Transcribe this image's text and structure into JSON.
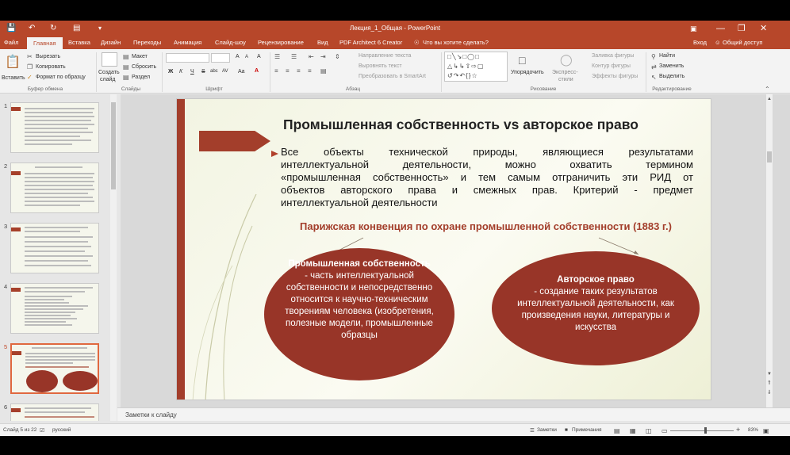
{
  "window": {
    "title": "Лекция_1_Общая - PowerPoint",
    "qa_icons": [
      "save-icon",
      "undo-icon",
      "redo-icon",
      "presentation-icon",
      "customize-icon"
    ],
    "controls": [
      "restore-ribbon-icon",
      "minimize-icon",
      "maximize-icon",
      "close-icon"
    ]
  },
  "tabs": [
    {
      "label": "Файл"
    },
    {
      "label": "Главная"
    },
    {
      "label": "Вставка"
    },
    {
      "label": "Дизайн"
    },
    {
      "label": "Переходы"
    },
    {
      "label": "Анимация"
    },
    {
      "label": "Слайд-шоу"
    },
    {
      "label": "Рецензирование"
    },
    {
      "label": "Вид"
    },
    {
      "label": "PDF Architect 6 Creator"
    },
    {
      "label": "Что вы хотите сделать?"
    }
  ],
  "tabs_right": {
    "signin": "Вход",
    "share": "Общий доступ"
  },
  "ribbon": {
    "clipboard": {
      "paste": "Вставить",
      "cut": "Вырезать",
      "copy": "Копировать",
      "format": "Формат по образцу",
      "label": "Буфер обмена"
    },
    "slides": {
      "create": "Создать",
      "slide": "слайд",
      "layout": "Макет",
      "reset": "Сбросить",
      "section": "Раздел",
      "label": "Слайды"
    },
    "font": {
      "label": "Шрифт",
      "bold": "Ж",
      "italic": "К",
      "underline": "Ч",
      "strike": "S",
      "shadow": "abc",
      "spacing": "AV",
      "case": "Aa",
      "color": "A",
      "grow": "A",
      "shrink": "A",
      "clear": "A"
    },
    "paragraph": {
      "direction": "Направление текста",
      "align": "Выровнять текст",
      "smartart": "Преобразовать в SmartArt",
      "label": "Абзац"
    },
    "drawing": {
      "arrange": "Упорядочить",
      "quick_styles": "Экспресс-",
      "quick_styles2": "стили",
      "fill": "Заливка фигуры",
      "outline": "Контур фигуры",
      "effects": "Эффекты фигуры",
      "label": "Рисование"
    },
    "editing": {
      "find": "Найти",
      "replace": "Заменить",
      "select": "Выделить",
      "label": "Редактирование"
    }
  },
  "thumbnails": [
    {
      "num": "1"
    },
    {
      "num": "2"
    },
    {
      "num": "3"
    },
    {
      "num": "4"
    },
    {
      "num": "5"
    },
    {
      "num": "6"
    }
  ],
  "slide": {
    "title": "Промышленная собственность vs авторское право",
    "bullet_lines": [
      "Все объекты технической природы, являющиеся результатами",
      "интеллектуальной деятельности, можно охватить термином",
      "«промышленная собственность» и тем самым отграничить эти РИД от",
      "объектов авторского права и смежных прав. Критерий - предмет",
      "интеллектуальной деятельности"
    ],
    "convention": "Парижская конвенция по охране промышленной собственности (1883 г.)",
    "left_title": "Промышленная собственность",
    "left_body": "- часть интеллектуальной собственности и непосредственно относится к научно-техническим творениям человека (изобретения, полезные модели, промышленные образцы",
    "right_title": "Авторское право",
    "right_body": "- создание таких результатов интеллектуальной деятельности, как произведения науки, литературы и искусства"
  },
  "notes": {
    "placeholder": "Заметки к слайду"
  },
  "status": {
    "slide_info": "Слайд 5 из 22",
    "language": "русский",
    "notes_btn": "Заметки",
    "comments_btn": "Примечания",
    "zoom": "83%"
  }
}
